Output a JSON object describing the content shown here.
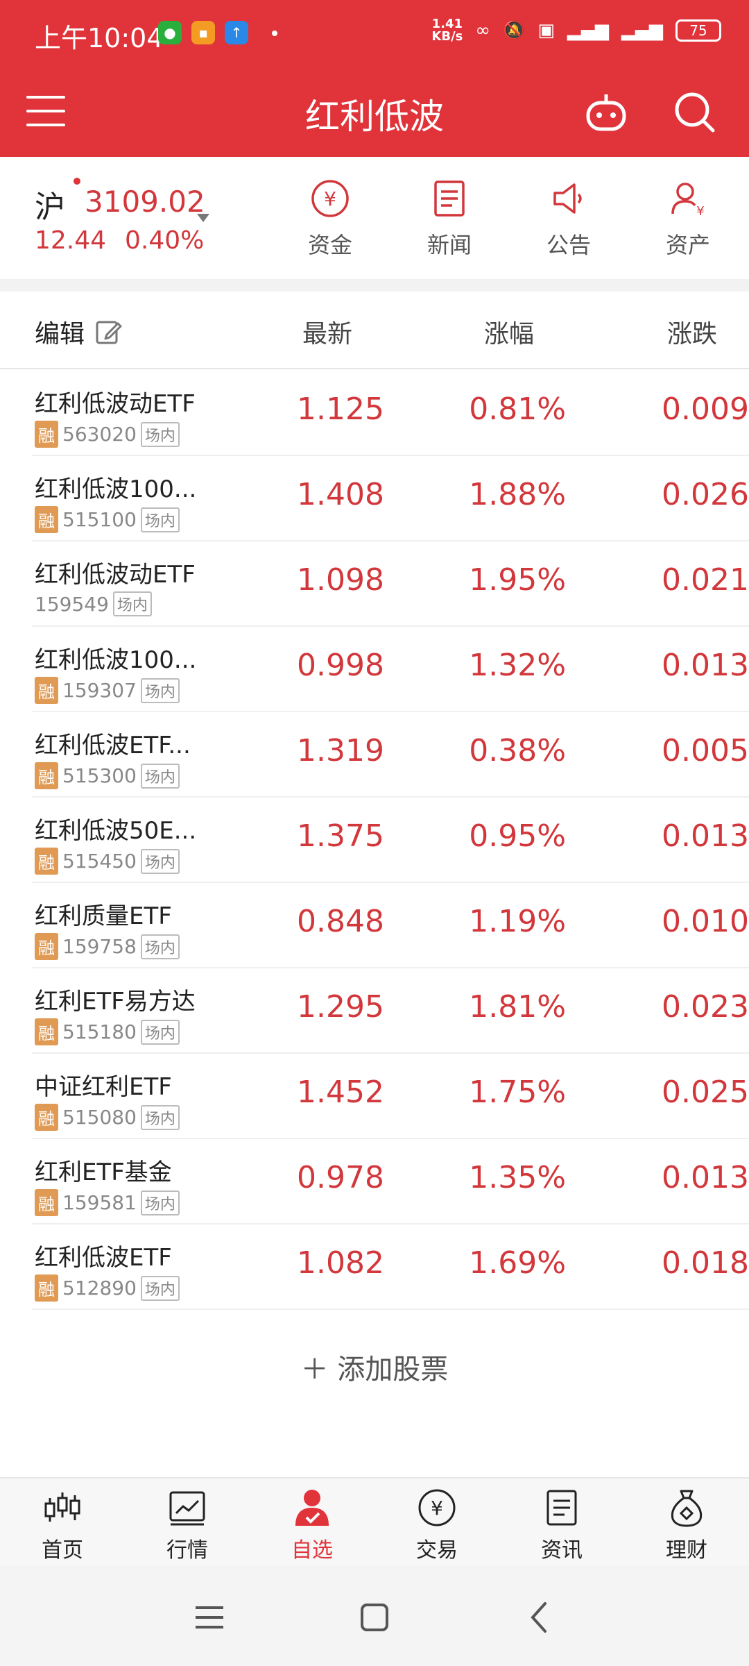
{
  "status": {
    "time": "上午10:04",
    "net_speed_line1": "1.41",
    "net_speed_line2": "KB/s",
    "battery": "75"
  },
  "header": {
    "title": "红利低波"
  },
  "index": {
    "name": "沪",
    "value": "3109.02",
    "change": "12.44",
    "percent": "0.40%"
  },
  "quick_actions": [
    {
      "label": "资金",
      "icon": "yuan-circle-icon"
    },
    {
      "label": "新闻",
      "icon": "newspaper-icon"
    },
    {
      "label": "公告",
      "icon": "megaphone-icon"
    },
    {
      "label": "资产",
      "icon": "user-asset-icon"
    }
  ],
  "columns": {
    "edit": "编辑",
    "latest": "最新",
    "pct": "涨幅",
    "chg": "涨跌"
  },
  "rows": [
    {
      "name": "红利低波动ETF",
      "rong": "融",
      "code": "563020",
      "tag": "场内",
      "latest": "1.125",
      "pct": "0.81%",
      "chg": "0.009"
    },
    {
      "name": "红利低波100...",
      "rong": "融",
      "code": "515100",
      "tag": "场内",
      "latest": "1.408",
      "pct": "1.88%",
      "chg": "0.026"
    },
    {
      "name": "红利低波动ETF",
      "rong": "",
      "code": "159549",
      "tag": "场内",
      "latest": "1.098",
      "pct": "1.95%",
      "chg": "0.021"
    },
    {
      "name": "红利低波100...",
      "rong": "融",
      "code": "159307",
      "tag": "场内",
      "latest": "0.998",
      "pct": "1.32%",
      "chg": "0.013"
    },
    {
      "name": "红利低波ETF...",
      "rong": "融",
      "code": "515300",
      "tag": "场内",
      "latest": "1.319",
      "pct": "0.38%",
      "chg": "0.005"
    },
    {
      "name": "红利低波50E...",
      "rong": "融",
      "code": "515450",
      "tag": "场内",
      "latest": "1.375",
      "pct": "0.95%",
      "chg": "0.013"
    },
    {
      "name": "红利质量ETF",
      "rong": "融",
      "code": "159758",
      "tag": "场内",
      "latest": "0.848",
      "pct": "1.19%",
      "chg": "0.010"
    },
    {
      "name": "红利ETF易方达",
      "rong": "融",
      "code": "515180",
      "tag": "场内",
      "latest": "1.295",
      "pct": "1.81%",
      "chg": "0.023"
    },
    {
      "name": "中证红利ETF",
      "rong": "融",
      "code": "515080",
      "tag": "场内",
      "latest": "1.452",
      "pct": "1.75%",
      "chg": "0.025"
    },
    {
      "name": "红利ETF基金",
      "rong": "融",
      "code": "159581",
      "tag": "场内",
      "latest": "0.978",
      "pct": "1.35%",
      "chg": "0.013"
    },
    {
      "name": "红利低波ETF",
      "rong": "融",
      "code": "512890",
      "tag": "场内",
      "latest": "1.082",
      "pct": "1.69%",
      "chg": "0.018"
    }
  ],
  "add_stock": "＋  添加股票",
  "bottom_nav": [
    {
      "label": "首页",
      "icon": "candlestick-icon",
      "active": false
    },
    {
      "label": "行情",
      "icon": "chart-line-icon",
      "active": false
    },
    {
      "label": "自选",
      "icon": "favorite-person-icon",
      "active": true
    },
    {
      "label": "交易",
      "icon": "yuan-circle-icon",
      "active": false
    },
    {
      "label": "资讯",
      "icon": "document-icon",
      "active": false
    },
    {
      "label": "理财",
      "icon": "money-bag-icon",
      "active": false
    }
  ],
  "colors": {
    "brand": "#e0333a",
    "up": "#d2373b",
    "badge": "#e09a53"
  }
}
